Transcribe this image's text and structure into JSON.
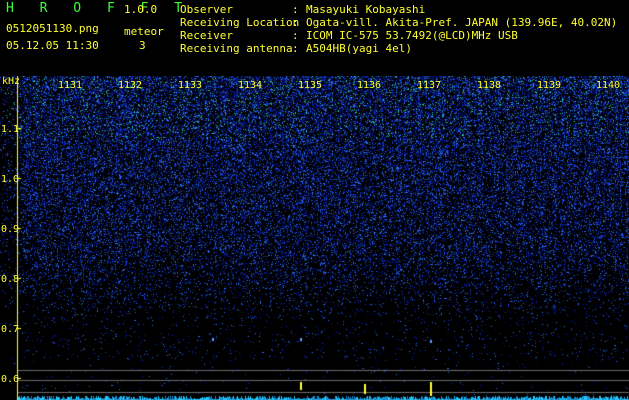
{
  "app": {
    "title": "H R O F F T",
    "version": "1.0.0"
  },
  "file": {
    "name": "0512051130.png",
    "timestamp": "05.12.05 11:30"
  },
  "meteor": {
    "label": "meteor",
    "count": "3"
  },
  "info": [
    {
      "key": "Observer",
      "value": "Masayuki Kobayashi"
    },
    {
      "key": "Receiving Location",
      "value": "Ogata-vill. Akita-Pref. JAPAN (139.96E, 40.02N)"
    },
    {
      "key": "Receiver",
      "value": "ICOM IC-575 53.7492(@LCD)MHz USB"
    },
    {
      "key": "Receiving antenna",
      "value": "A504HB(yagi 4el)"
    }
  ],
  "colon": ":",
  "spectrogram": {
    "y_unit": "kHz",
    "y_ticks": [
      "1.1",
      "1.0",
      "0.9",
      "0.8",
      "0.7",
      "0.6"
    ],
    "time_ticks": [
      "1131",
      "1132",
      "1133",
      "1134",
      "1135",
      "1136",
      "1137",
      "1138",
      "1139",
      "1140"
    ],
    "colors": {
      "background": "#000000",
      "signal_low": "#0a1a9a",
      "signal_high": "#35e0e0",
      "marker": "#ffff33",
      "baseline": "#20c8ff"
    },
    "meteor_marks": [
      "1134",
      "1135",
      "1136"
    ]
  }
}
